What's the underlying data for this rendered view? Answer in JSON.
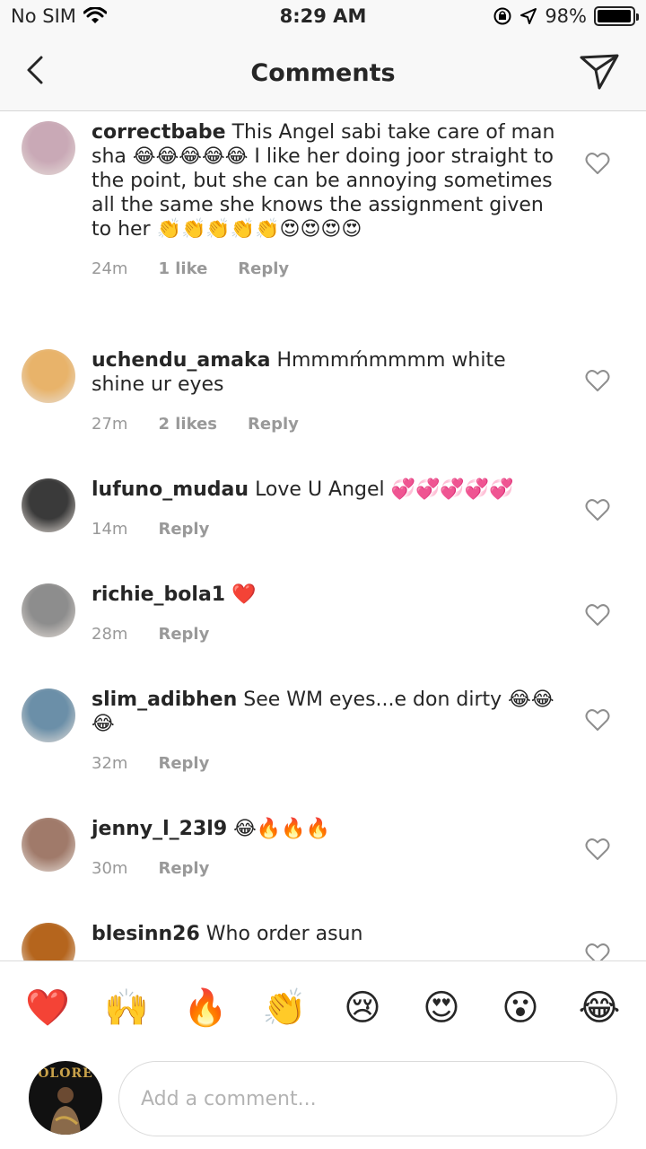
{
  "status": {
    "carrier": "No SIM",
    "time": "8:29 AM",
    "battery": "98%",
    "battery_level": 0.98
  },
  "nav": {
    "title": "Comments",
    "back_icon": "back-chevron-icon",
    "send_icon": "send-icon"
  },
  "comments": [
    {
      "username": "correctbabe",
      "text": "This Angel sabi take care of man sha 😂😂😂😂😂 I like her doing joor straight to the point, but she can be annoying sometimes all the same she knows the assignment given to her 👏👏👏👏👏😍😍😍😍",
      "time": "24m",
      "likes": "1 like",
      "reply": "Reply",
      "avatar_color": "#c9a9b6"
    },
    {
      "username": "uchendu_amaka",
      "text": "Hmmmḿmmmm white shine ur eyes",
      "time": "27m",
      "likes": "2 likes",
      "reply": "Reply",
      "avatar_color": "#e8b36a"
    },
    {
      "username": "lufuno_mudau",
      "text": "Love U Angel 💞💞💞💞💞",
      "time": "14m",
      "likes": "",
      "reply": "Reply",
      "avatar_color": "#3a3a3a"
    },
    {
      "username": "richie_bola1",
      "text": "❤️",
      "time": "28m",
      "likes": "",
      "reply": "Reply",
      "avatar_color": "#8d8d8d"
    },
    {
      "username": "slim_adibhen",
      "text": "See WM eyes...e don dirty 😂😂😂",
      "time": "32m",
      "likes": "",
      "reply": "Reply",
      "avatar_color": "#6b8fa8"
    },
    {
      "username": "jenny_l_23l9",
      "text": "😂🔥🔥🔥",
      "time": "30m",
      "likes": "",
      "reply": "Reply",
      "avatar_color": "#a07a6a"
    },
    {
      "username": "blesinn26",
      "text": "Who order asun",
      "time": "",
      "likes": "",
      "reply": "",
      "avatar_color": "#b5651d"
    }
  ],
  "emoji_bar": [
    "❤️",
    "🙌",
    "🔥",
    "👏",
    "😢",
    "😍",
    "😮",
    "😂"
  ],
  "input": {
    "placeholder": "Add a comment...",
    "avatar_text": "OLORE"
  }
}
